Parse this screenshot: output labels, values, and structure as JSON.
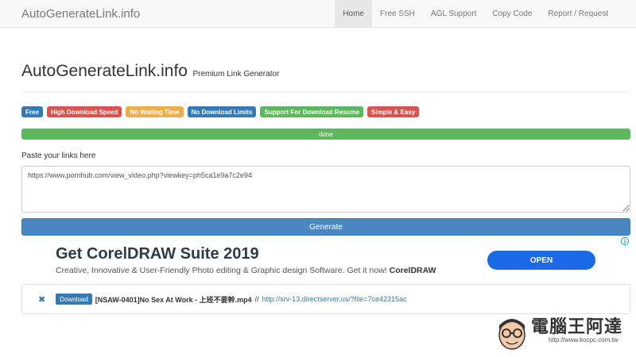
{
  "navbar": {
    "brand": "AutoGenerateLink.info",
    "items": [
      {
        "label": "Home",
        "active": true
      },
      {
        "label": "Free SSH",
        "active": false
      },
      {
        "label": "AGL Support",
        "active": false
      },
      {
        "label": "Copy Code",
        "active": false
      },
      {
        "label": "Report / Request",
        "active": false
      }
    ]
  },
  "header": {
    "title": "AutoGenerateLink.info",
    "subtitle": "Premium Link Generator"
  },
  "badges": [
    {
      "label": "Free",
      "color": "#337ab7"
    },
    {
      "label": "High Download Speed",
      "color": "#d9534f"
    },
    {
      "label": "No Waiting Time",
      "color": "#f0ad4e"
    },
    {
      "label": "No Download Limits",
      "color": "#337ab7"
    },
    {
      "label": "Support For Download Resume",
      "color": "#5cb85c"
    },
    {
      "label": "Simple & Easy",
      "color": "#d9534f"
    }
  ],
  "progress": {
    "label": "done",
    "percent": 100,
    "color": "#5cb85c"
  },
  "form": {
    "paste_label": "Paste your links here",
    "links_value": "https://www.pornhub.com/view_video.php?viewkey=ph5ca1e9a7c2e94",
    "generate_label": "Generate"
  },
  "ad": {
    "title": "Get CorelDRAW Suite 2019",
    "description": "Creative, Innovative & User-Friendly Photo editing & Graphic design Software. Get it now!",
    "brand": "CorelDRAW",
    "open_label": "OPEN",
    "choices_icon": "ad-choices-icon"
  },
  "result": {
    "remove_icon": "close-icon",
    "download_label": "Download",
    "file_name": "[NSAW-0401]No Sex At Work - 上班不要幹.mp4",
    "separator": "//",
    "link": "http://srv-13.directserver.us/?file=7ce42315ac"
  },
  "watermark": {
    "text": "電腦王阿達",
    "url": "http://www.kocpc.com.tw"
  }
}
